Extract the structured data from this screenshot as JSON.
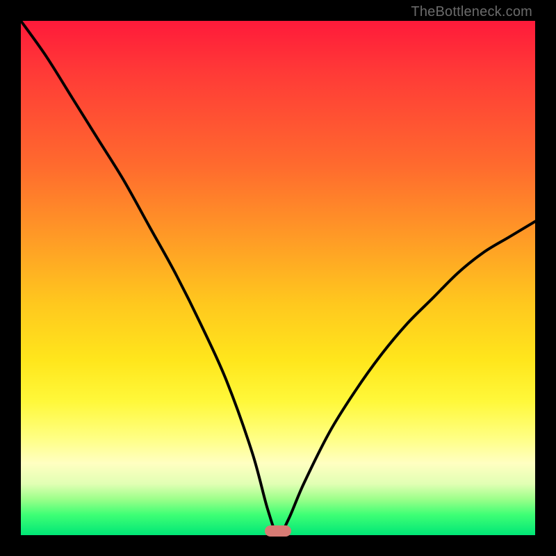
{
  "watermark": "TheBottleneck.com",
  "colors": {
    "frame": "#000000",
    "curve": "#000000",
    "marker": "#d77b74",
    "gradient_top": "#ff1a3a",
    "gradient_bottom": "#00e676"
  },
  "chart_data": {
    "type": "line",
    "title": "",
    "xlabel": "",
    "ylabel": "",
    "xlim": [
      0,
      100
    ],
    "ylim": [
      0,
      100
    ],
    "x": [
      0,
      5,
      10,
      15,
      20,
      25,
      30,
      35,
      40,
      45,
      48,
      50,
      52,
      55,
      60,
      65,
      70,
      75,
      80,
      85,
      90,
      95,
      100
    ],
    "values": [
      100,
      93,
      85,
      77,
      69,
      60,
      51,
      41,
      30,
      16,
      5,
      0,
      3,
      10,
      20,
      28,
      35,
      41,
      46,
      51,
      55,
      58,
      61
    ],
    "optimum_x": 50,
    "optimum_y": 0,
    "note": "x is relative component scale (0-100); y is bottleneck percentage (0 = no bottleneck / green, 100 = severe / red). Curve minimum near x=50."
  }
}
